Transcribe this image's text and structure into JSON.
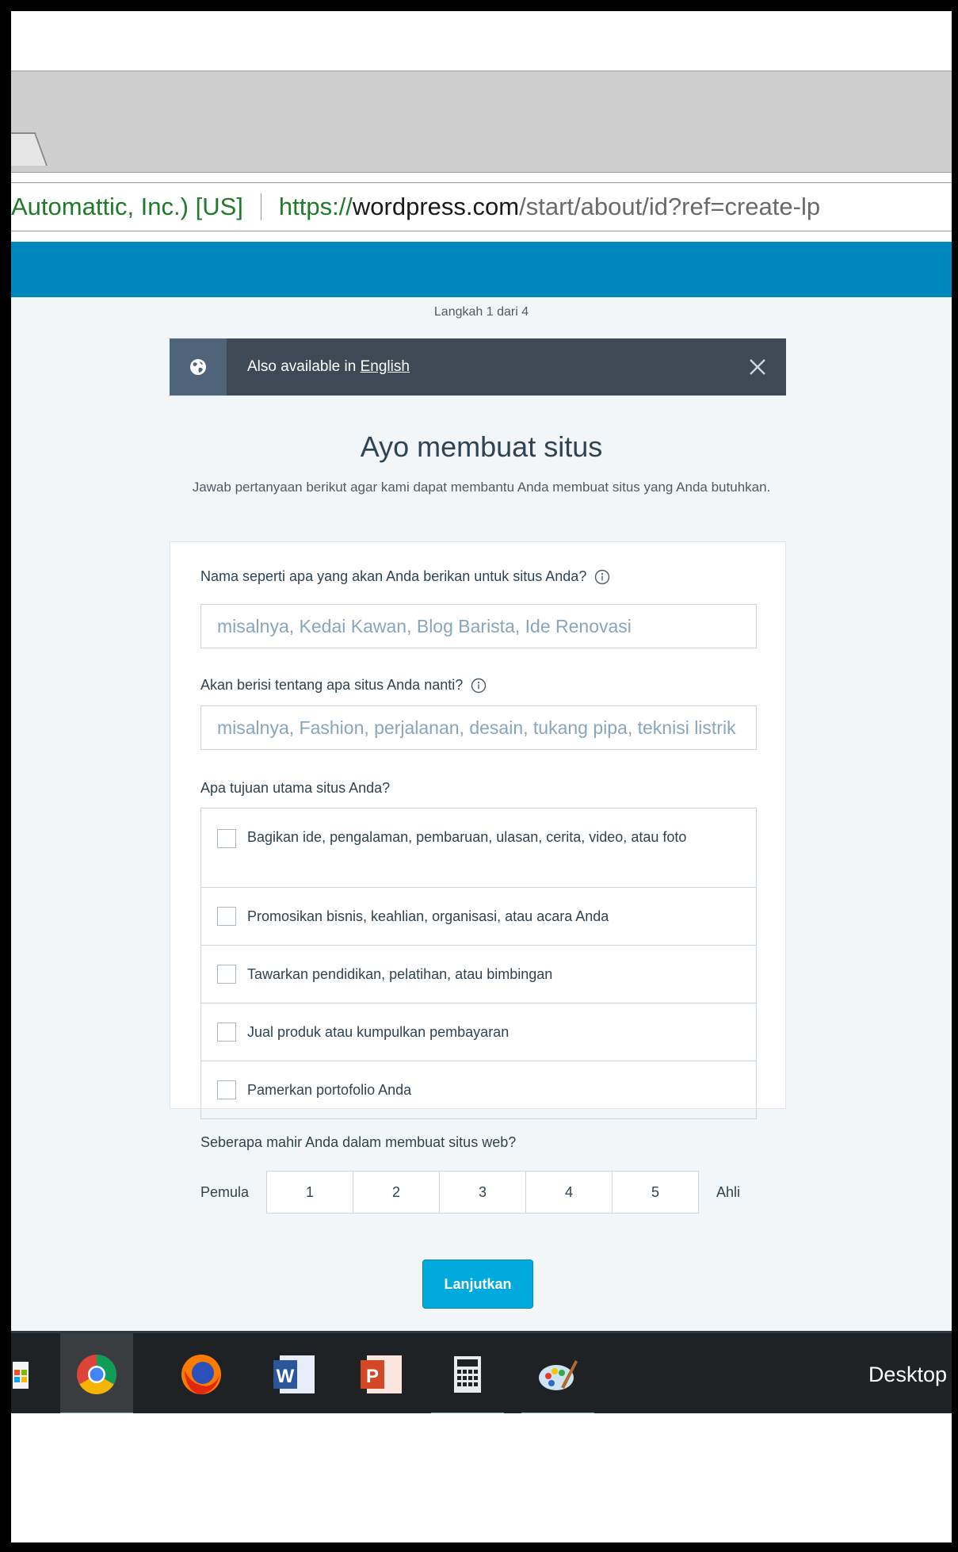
{
  "browser": {
    "cert_label": "Automattic, Inc.) [US]",
    "url_scheme": "https://",
    "url_host": "wordpress.com",
    "url_path": "/start/about/id?ref=create-lp"
  },
  "signup": {
    "step_text": "Langkah 1 dari 4",
    "notice": {
      "text": "Also available in ",
      "link": "English"
    },
    "heading": "Ayo membuat situs",
    "subheading": "Jawab pertanyaan berikut agar kami dapat membantu Anda membuat situs yang Anda butuhkan.",
    "site_name": {
      "label": "Nama seperti apa yang akan Anda berikan untuk situs Anda?",
      "placeholder": "misalnya, Kedai Kawan, Blog Barista, Ide Renovasi",
      "value": ""
    },
    "site_topic": {
      "label": "Akan berisi tentang apa situs Anda nanti?",
      "placeholder": "misalnya, Fashion, perjalanan, desain, tukang pipa, teknisi listrik",
      "value": ""
    },
    "goals": {
      "label": "Apa tujuan utama situs Anda?",
      "items": [
        "Bagikan ide, pengalaman, pembaruan, ulasan, cerita, video, atau foto",
        "Promosikan bisnis, keahlian, organisasi, atau acara Anda",
        "Tawarkan pendidikan, pelatihan, atau bimbingan",
        "Jual produk atau kumpulkan pembayaran",
        "Pamerkan portofolio Anda"
      ]
    },
    "experience": {
      "label": "Seberapa mahir Anda dalam membuat situs web?",
      "low_label": "Pemula",
      "high_label": "Ahli",
      "options": [
        "1",
        "2",
        "3",
        "4",
        "5"
      ]
    },
    "continue_label": "Lanjutkan"
  },
  "taskbar": {
    "icons": [
      "store-icon",
      "chrome-icon",
      "firefox-icon",
      "word-icon",
      "powerpoint-icon",
      "calculator-icon",
      "paint-icon"
    ],
    "desktop_label": "Desktop"
  },
  "colors": {
    "wp_blue": "#0087be",
    "button_blue": "#00aadc",
    "notice_dark": "#3d4a55"
  }
}
